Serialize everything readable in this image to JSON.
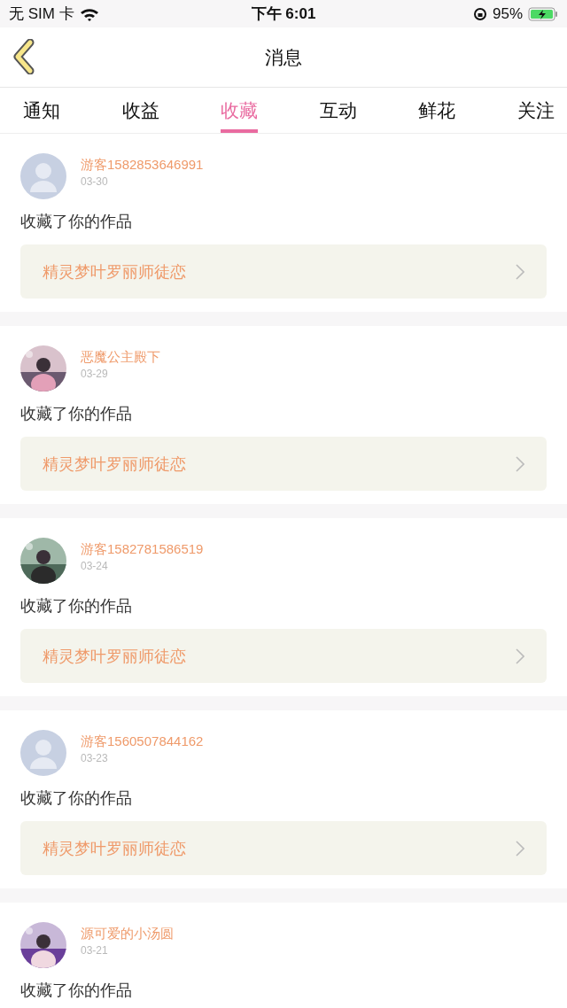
{
  "status_bar": {
    "carrier": "无 SIM 卡",
    "time": "下午 6:01",
    "battery": "95%"
  },
  "nav": {
    "title": "消息"
  },
  "tabs": [
    {
      "label": "通知",
      "selected": false
    },
    {
      "label": "收益",
      "selected": false
    },
    {
      "label": "收藏",
      "selected": true
    },
    {
      "label": "互动",
      "selected": false
    },
    {
      "label": "鲜花",
      "selected": false
    },
    {
      "label": "关注",
      "selected": false
    }
  ],
  "messages": [
    {
      "avatar": {
        "kind": "default"
      },
      "user": "游客1582853646991",
      "date": "03-30",
      "action": "收藏了你的作品",
      "work": "精灵梦叶罗丽师徒恋"
    },
    {
      "user": "恶魔公主殿下",
      "date": "03-29",
      "action": "收藏了你的作品",
      "work": "精灵梦叶罗丽师徒恋"
    },
    {
      "user": "游客1582781586519",
      "date": "03-24",
      "action": "收藏了你的作品",
      "work": "精灵梦叶罗丽师徒恋"
    },
    {
      "avatar": {
        "kind": "default"
      },
      "user": "游客1560507844162",
      "date": "03-23",
      "action": "收藏了你的作品",
      "work": "精灵梦叶罗丽师徒恋"
    },
    {
      "user": "源可爱的小汤圆",
      "date": "03-21",
      "action": "收藏了你的作品"
    }
  ]
}
